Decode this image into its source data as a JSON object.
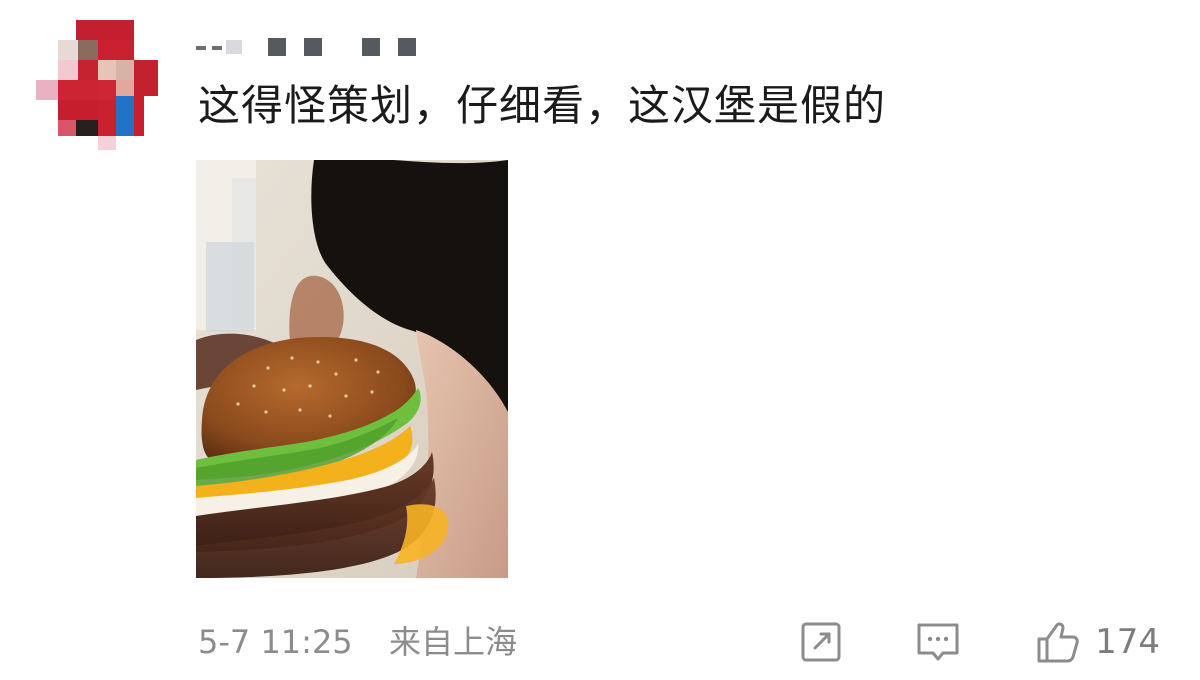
{
  "comment": {
    "username": "",
    "text": "这得怪策划，仔细看，这汉堡是假的",
    "date": "5-7 11:25",
    "location": "来自上海"
  },
  "actions": {
    "like_count": "174"
  },
  "icons": {
    "share": "share-icon",
    "reply": "comment-icon",
    "like": "thumbs-up-icon"
  },
  "colors": {
    "text": "#1b1b1b",
    "meta": "#8c8c8c",
    "avatar_red": "#c8202c"
  }
}
